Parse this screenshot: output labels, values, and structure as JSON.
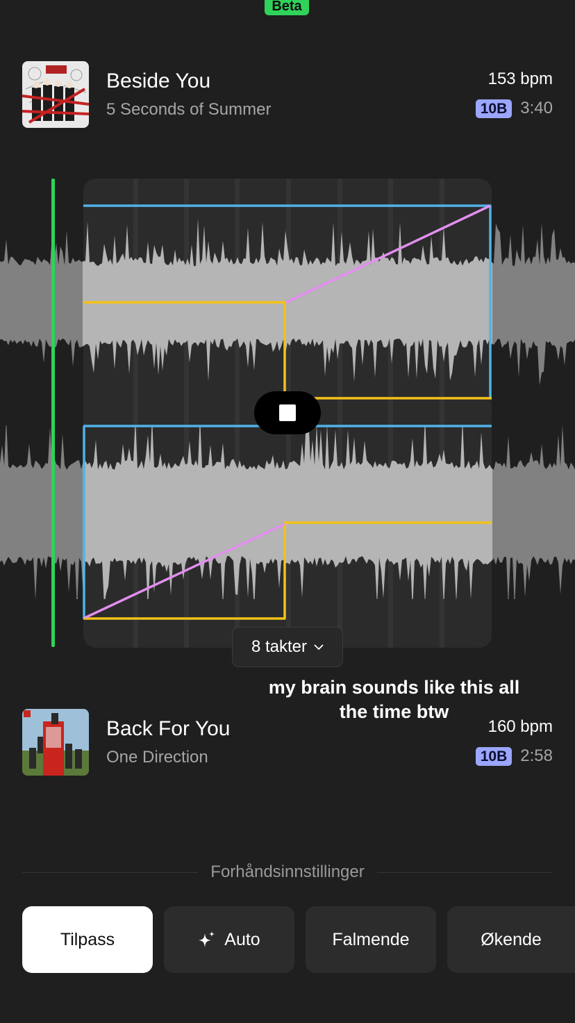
{
  "header": {
    "badge": "Beta"
  },
  "tracks": {
    "current": {
      "title": "Beside You",
      "artist": "5 Seconds of Summer",
      "bpm": "153 bpm",
      "key": "10B",
      "duration": "3:40"
    },
    "next": {
      "title": "Back For You",
      "artist": "One Direction",
      "bpm": "160 bpm",
      "key": "10B",
      "duration": "2:58"
    }
  },
  "transition": {
    "length_label": "8 takter",
    "chevron": "chevron-down-icon"
  },
  "caption": "my brain sounds like this all the time btw",
  "presets": {
    "label": "Forhåndsinnstillinger",
    "buttons": [
      {
        "label": "Tilpass",
        "active": true
      },
      {
        "label": "Auto",
        "icon": "sparkle-icon"
      },
      {
        "label": "Falmende"
      },
      {
        "label": "Økende"
      }
    ]
  },
  "colors": {
    "accent_green": "#2fd35a",
    "key_badge": "#9aa6ff",
    "volume_line": "#f3c21a",
    "eq_line": "#4fb3e8",
    "fade_line": "#e38ef0"
  }
}
